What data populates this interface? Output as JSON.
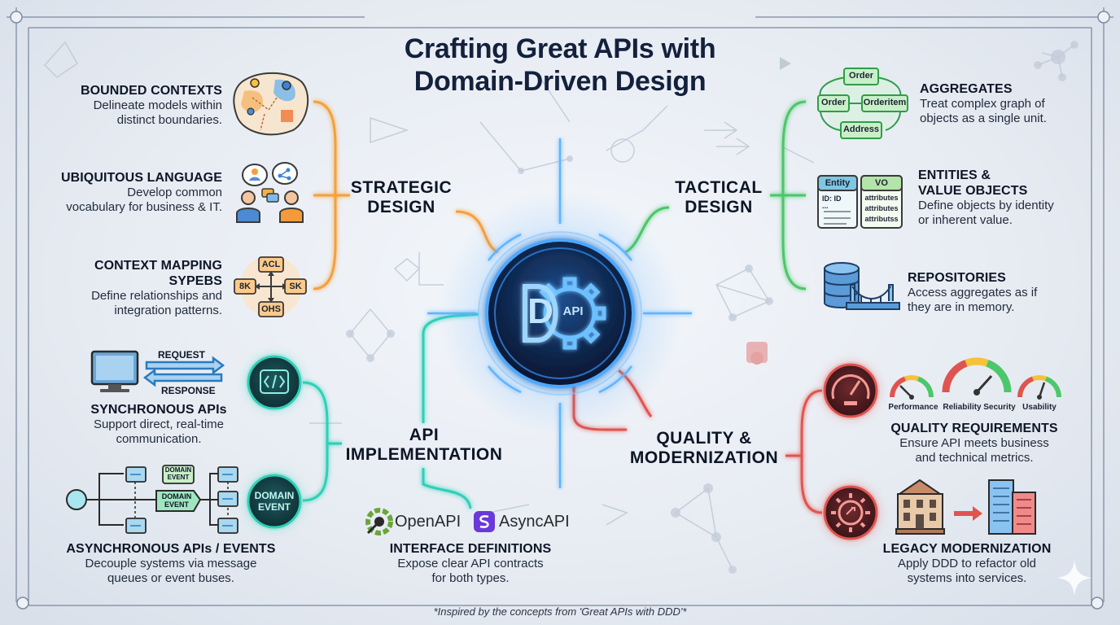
{
  "title": {
    "line1": "Crafting Great APIs with",
    "line2": "Domain-Driven Design"
  },
  "hub": {
    "center_icon_letter": "D",
    "center_icon_api": "API",
    "strategic_line1": "STRATEGIC",
    "strategic_line2": "DESIGN",
    "tactical_line1": "TACTICAL",
    "tactical_line2": "DESIGN",
    "implementation_line1": "API",
    "implementation_line2": "IMPLEMENTATION",
    "quality_line1": "QUALITY &",
    "quality_line2": "MODERNIZATION"
  },
  "strategic": {
    "bounded": {
      "title": "BOUNDED CONTEXTS",
      "desc1": "Delineate models within",
      "desc2": "distinct boundaries."
    },
    "ubiquitous": {
      "title": "UBIQUITOUS LANGUAGE",
      "desc1": "Develop common",
      "desc2": "vocabulary for business & IT."
    },
    "mapping": {
      "title1": "CONTEXT MAPPING",
      "title2": "SYPEBS",
      "desc1": "Define relationships and",
      "desc2": "integration patterns.",
      "node_top": "ACL",
      "node_left": "8K",
      "node_right": "SK",
      "node_bottom": "OHS"
    }
  },
  "tactical": {
    "aggregates": {
      "title": "AGGREGATES",
      "desc1": "Treat complex graph of",
      "desc2": "objects as a single unit.",
      "node_top": "Order",
      "node_left": "Order",
      "node_right": "Orderitem",
      "node_bottom": "Address"
    },
    "entities": {
      "title1": "ENTITIES &",
      "title2": "VALUE OBJECTS",
      "desc1": "Define objects by identity",
      "desc2": "or inherent value.",
      "entity_label": "Entity",
      "entity_id": "ID: ID",
      "entity_dots": "...",
      "vo_label": "VO",
      "vo_attr1": "attributes",
      "vo_attr2": "attributes",
      "vo_attr3": "attributss"
    },
    "repositories": {
      "title": "REPOSITORIES",
      "desc1": "Access aggregates as if",
      "desc2": "they are in memory."
    }
  },
  "implementation": {
    "request_label": "REQUEST",
    "response_label": "RESPONSE",
    "sync": {
      "title": "SYNCHRONOUS APIs",
      "desc1": "Support direct, real-time",
      "desc2": "communication."
    },
    "domain_event_badge1": "DOMAIN",
    "domain_event_badge2": "EVENT",
    "flow_event_top1": "DOMAIN",
    "flow_event_top2": "EVENT",
    "flow_event_mid1": "DOMAIN",
    "flow_event_mid2": "EVENT",
    "async": {
      "title": "ASYNCHRONOUS APIs / EVENTS",
      "desc1": "Decouple systems via message",
      "desc2": "queues or event buses."
    },
    "openapi_label": "OpenAPI",
    "asyncapi_label": "AsyncAPI",
    "interface": {
      "title": "INTERFACE DEFINITIONS",
      "desc1": "Expose clear API contracts",
      "desc2": "for both types."
    }
  },
  "quality": {
    "gauges": [
      "Performance",
      "Reliability",
      "Security",
      "Usability"
    ],
    "requirements": {
      "title": "QUALITY REQUIREMENTS",
      "desc1": "Ensure API meets business",
      "desc2": "and technical metrics."
    },
    "legacy": {
      "title": "LEGACY MODERNIZATION",
      "desc1": "Apply DDD to refactor old",
      "desc2": "systems into services."
    }
  },
  "footer": "*Inspired by the concepts from 'Great APIs with DDD'*",
  "colors": {
    "strategic": "#f5a03a",
    "tactical": "#4cc76a",
    "implementation": "#2fd0b8",
    "quality": "#e0544f",
    "hub_blue": "#2f8ff0",
    "text_dark": "#0d1626"
  }
}
